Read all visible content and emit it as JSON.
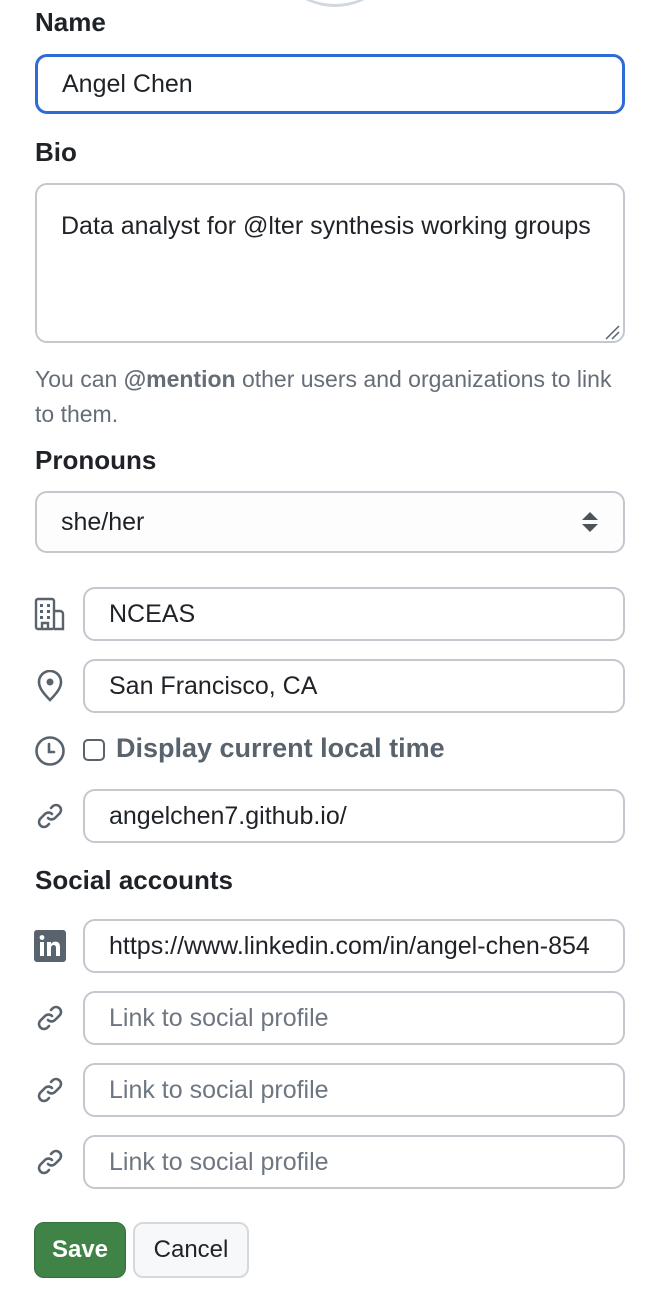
{
  "profile_form": {
    "name": {
      "label": "Name",
      "value": "Angel Chen"
    },
    "bio": {
      "label": "Bio",
      "value": "Data analyst for @lter synthesis working groups",
      "note_prefix": "You can ",
      "note_mention": "@mention",
      "note_suffix": " other users and organizations to link to them."
    },
    "pronouns": {
      "label": "Pronouns",
      "selected": "she/her"
    },
    "company": {
      "icon": "organization-icon",
      "value": "NCEAS"
    },
    "location": {
      "icon": "location-pin-icon",
      "value": "San Francisco, CA"
    },
    "local_time": {
      "icon": "clock-icon",
      "label": "Display current local time",
      "checked": false
    },
    "website": {
      "icon": "link-icon",
      "value": "angelchen7.github.io/"
    },
    "social_accounts": {
      "label": "Social accounts",
      "items": [
        {
          "icon": "linkedin-icon",
          "value": "https://www.linkedin.com/in/angel-chen-854",
          "placeholder": "Link to social profile"
        },
        {
          "icon": "link-icon",
          "value": "",
          "placeholder": "Link to social profile"
        },
        {
          "icon": "link-icon",
          "value": "",
          "placeholder": "Link to social profile"
        },
        {
          "icon": "link-icon",
          "value": "",
          "placeholder": "Link to social profile"
        }
      ]
    },
    "buttons": {
      "save": "Save",
      "cancel": "Cancel"
    },
    "colors": {
      "focus_border": "#2f6bd6",
      "save_bg": "#3f8446",
      "muted_text": "#656d76"
    }
  }
}
